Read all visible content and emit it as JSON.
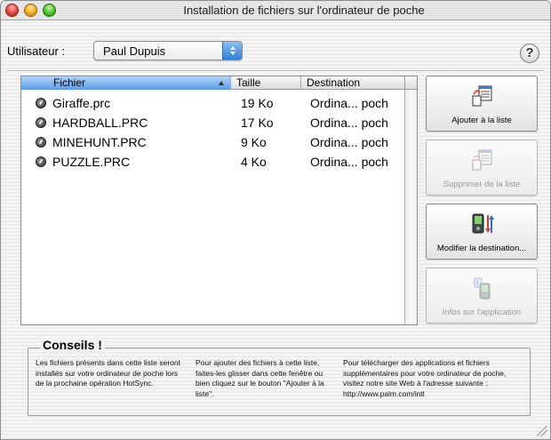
{
  "window": {
    "title": "Installation de fichiers sur l'ordinateur de poche"
  },
  "user": {
    "label": "Utilisateur :",
    "selected": "Paul Dupuis"
  },
  "help": {
    "label": "?"
  },
  "file_list": {
    "columns": [
      "Fichier",
      "Taille",
      "Destination"
    ],
    "sort_column": "Fichier",
    "rows": [
      {
        "name": "Giraffe.prc",
        "size": "19 Ko",
        "destination": "Ordina... poch"
      },
      {
        "name": "HARDBALL.PRC",
        "size": "17 Ko",
        "destination": "Ordina... poch"
      },
      {
        "name": "MINEHUNT.PRC",
        "size": "9 Ko",
        "destination": "Ordina... poch"
      },
      {
        "name": "PUZZLE.PRC",
        "size": "4 Ko",
        "destination": "Ordina... poch"
      }
    ]
  },
  "buttons": {
    "add": {
      "label": "Ajouter à la liste",
      "icon": "add-to-list-icon",
      "enabled": true
    },
    "remove": {
      "label": "Supprimer de la liste",
      "icon": "remove-from-list-icon",
      "enabled": false
    },
    "destination": {
      "label": "Modifier la destination...",
      "icon": "change-destination-icon",
      "enabled": true
    },
    "info": {
      "label": "Infos sur l'application",
      "icon": "app-info-icon",
      "enabled": false
    }
  },
  "tips": {
    "title": "Conseils !",
    "text1": "Les fichiers présents dans cette liste seront installés sur votre ordinateur de poche lors de la prochaine opération HotSync.",
    "text2": "Pour ajouter des fichiers à cette liste, faites-les glisser dans cette fenêtre ou bien cliquez sur le bouton \"Ajouter à la liste\".",
    "text3": "Pour télécharger des applications et fichiers supplémentaires pour votre ordinateur de poche, visitez notre site Web à l'adresse suivante : http://www.palm.com/intl"
  },
  "colors": {
    "selection_blue": "#5b9ae6",
    "close": "#e0443a",
    "minimize": "#f1a91c",
    "zoom": "#4cbf2e"
  }
}
